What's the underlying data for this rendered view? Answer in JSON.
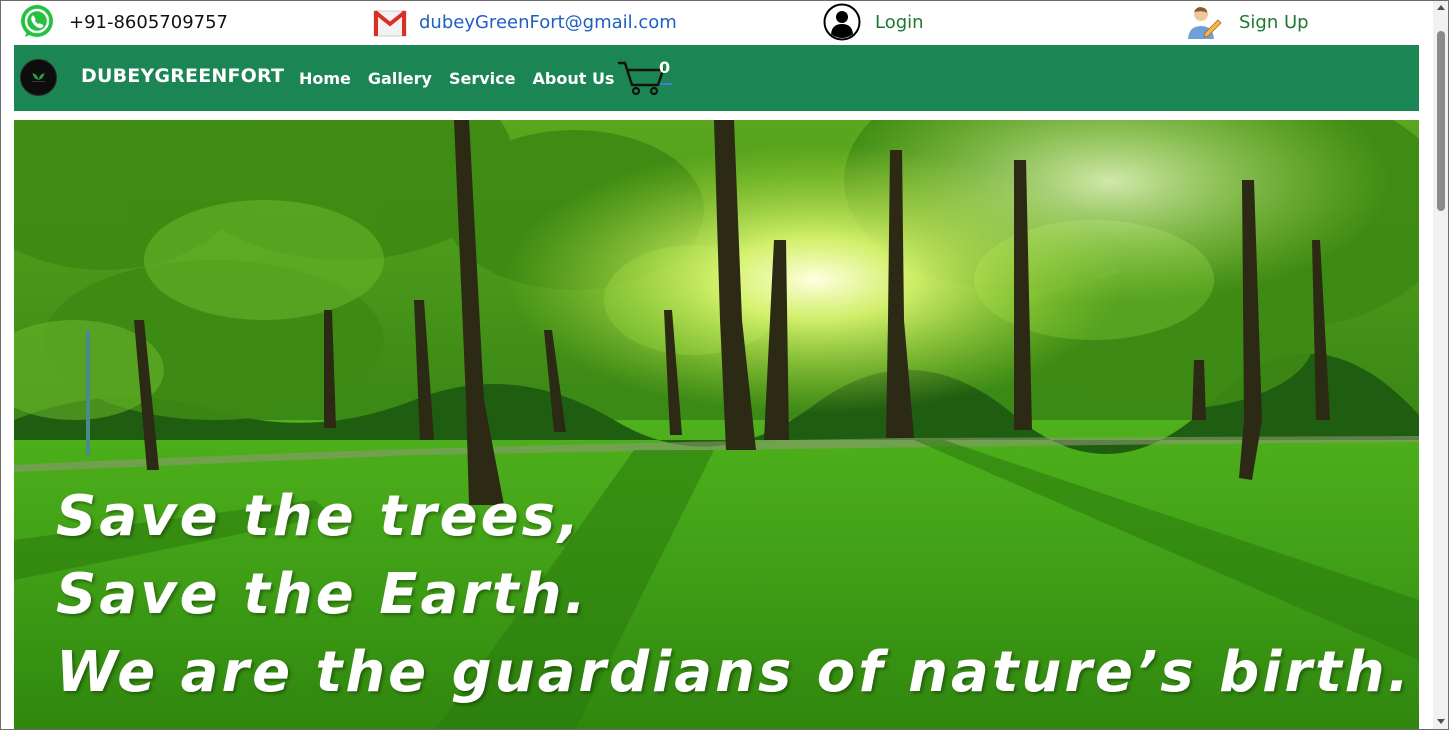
{
  "contact": {
    "phone": "+91-8605709757",
    "email": "dubeyGreenFort@gmail.com",
    "login_label": "Login",
    "signup_label": "Sign Up"
  },
  "nav": {
    "brand": "DUBEYGREENFORT",
    "links": [
      "Home",
      "Gallery",
      "Service",
      "About Us"
    ],
    "cart_count": "0"
  },
  "hero": {
    "line1": "Save the trees,",
    "line2": "Save the Earth.",
    "line3": "We are the guardians of nature’s birth."
  },
  "icons": {
    "phone": "whatsapp-icon",
    "email": "gmail-icon",
    "login": "user-circle-icon",
    "signup": "user-pen-icon",
    "cart": "cart-icon"
  },
  "colors": {
    "nav_bg": "#1b8553",
    "link_green": "#1a7a2e",
    "email_blue": "#1f5fc2"
  }
}
